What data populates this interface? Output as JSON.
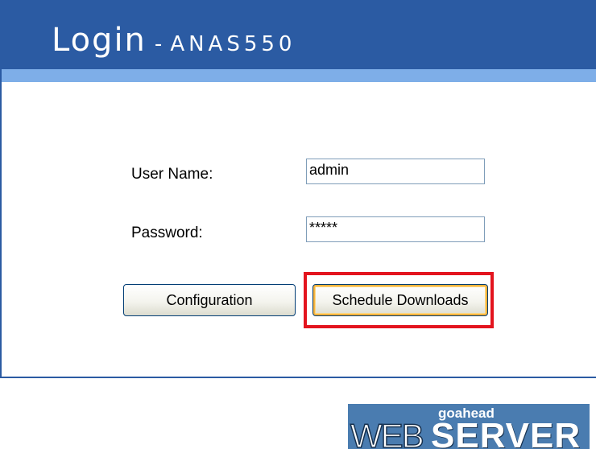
{
  "header": {
    "title_main": "Login",
    "title_sep": "-",
    "title_device": "ANAS550"
  },
  "form": {
    "username_label": "User Name:",
    "username_value": "admin",
    "password_label": "Password:",
    "password_value": "*****"
  },
  "buttons": {
    "configuration_label": "Configuration",
    "schedule_label": "Schedule Downloads"
  },
  "logo": {
    "top_text": "goahead",
    "web_text": "WEB",
    "server_text": "SERVER"
  },
  "colors": {
    "header_blue": "#2b5ba3",
    "stripe_blue": "#7eaee8",
    "highlight_red": "#e3141e"
  }
}
